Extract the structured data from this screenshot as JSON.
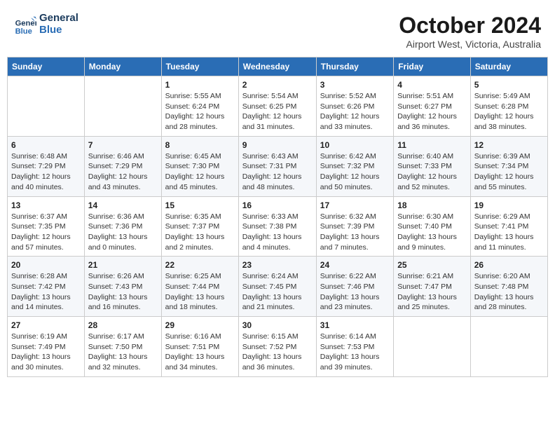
{
  "header": {
    "logo_line1": "General",
    "logo_line2": "Blue",
    "title": "October 2024",
    "subtitle": "Airport West, Victoria, Australia"
  },
  "calendar": {
    "days_of_week": [
      "Sunday",
      "Monday",
      "Tuesday",
      "Wednesday",
      "Thursday",
      "Friday",
      "Saturday"
    ],
    "weeks": [
      [
        {
          "day": "",
          "info": ""
        },
        {
          "day": "",
          "info": ""
        },
        {
          "day": "1",
          "info": "Sunrise: 5:55 AM\nSunset: 6:24 PM\nDaylight: 12 hours and 28 minutes."
        },
        {
          "day": "2",
          "info": "Sunrise: 5:54 AM\nSunset: 6:25 PM\nDaylight: 12 hours and 31 minutes."
        },
        {
          "day": "3",
          "info": "Sunrise: 5:52 AM\nSunset: 6:26 PM\nDaylight: 12 hours and 33 minutes."
        },
        {
          "day": "4",
          "info": "Sunrise: 5:51 AM\nSunset: 6:27 PM\nDaylight: 12 hours and 36 minutes."
        },
        {
          "day": "5",
          "info": "Sunrise: 5:49 AM\nSunset: 6:28 PM\nDaylight: 12 hours and 38 minutes."
        }
      ],
      [
        {
          "day": "6",
          "info": "Sunrise: 6:48 AM\nSunset: 7:29 PM\nDaylight: 12 hours and 40 minutes."
        },
        {
          "day": "7",
          "info": "Sunrise: 6:46 AM\nSunset: 7:29 PM\nDaylight: 12 hours and 43 minutes."
        },
        {
          "day": "8",
          "info": "Sunrise: 6:45 AM\nSunset: 7:30 PM\nDaylight: 12 hours and 45 minutes."
        },
        {
          "day": "9",
          "info": "Sunrise: 6:43 AM\nSunset: 7:31 PM\nDaylight: 12 hours and 48 minutes."
        },
        {
          "day": "10",
          "info": "Sunrise: 6:42 AM\nSunset: 7:32 PM\nDaylight: 12 hours and 50 minutes."
        },
        {
          "day": "11",
          "info": "Sunrise: 6:40 AM\nSunset: 7:33 PM\nDaylight: 12 hours and 52 minutes."
        },
        {
          "day": "12",
          "info": "Sunrise: 6:39 AM\nSunset: 7:34 PM\nDaylight: 12 hours and 55 minutes."
        }
      ],
      [
        {
          "day": "13",
          "info": "Sunrise: 6:37 AM\nSunset: 7:35 PM\nDaylight: 12 hours and 57 minutes."
        },
        {
          "day": "14",
          "info": "Sunrise: 6:36 AM\nSunset: 7:36 PM\nDaylight: 13 hours and 0 minutes."
        },
        {
          "day": "15",
          "info": "Sunrise: 6:35 AM\nSunset: 7:37 PM\nDaylight: 13 hours and 2 minutes."
        },
        {
          "day": "16",
          "info": "Sunrise: 6:33 AM\nSunset: 7:38 PM\nDaylight: 13 hours and 4 minutes."
        },
        {
          "day": "17",
          "info": "Sunrise: 6:32 AM\nSunset: 7:39 PM\nDaylight: 13 hours and 7 minutes."
        },
        {
          "day": "18",
          "info": "Sunrise: 6:30 AM\nSunset: 7:40 PM\nDaylight: 13 hours and 9 minutes."
        },
        {
          "day": "19",
          "info": "Sunrise: 6:29 AM\nSunset: 7:41 PM\nDaylight: 13 hours and 11 minutes."
        }
      ],
      [
        {
          "day": "20",
          "info": "Sunrise: 6:28 AM\nSunset: 7:42 PM\nDaylight: 13 hours and 14 minutes."
        },
        {
          "day": "21",
          "info": "Sunrise: 6:26 AM\nSunset: 7:43 PM\nDaylight: 13 hours and 16 minutes."
        },
        {
          "day": "22",
          "info": "Sunrise: 6:25 AM\nSunset: 7:44 PM\nDaylight: 13 hours and 18 minutes."
        },
        {
          "day": "23",
          "info": "Sunrise: 6:24 AM\nSunset: 7:45 PM\nDaylight: 13 hours and 21 minutes."
        },
        {
          "day": "24",
          "info": "Sunrise: 6:22 AM\nSunset: 7:46 PM\nDaylight: 13 hours and 23 minutes."
        },
        {
          "day": "25",
          "info": "Sunrise: 6:21 AM\nSunset: 7:47 PM\nDaylight: 13 hours and 25 minutes."
        },
        {
          "day": "26",
          "info": "Sunrise: 6:20 AM\nSunset: 7:48 PM\nDaylight: 13 hours and 28 minutes."
        }
      ],
      [
        {
          "day": "27",
          "info": "Sunrise: 6:19 AM\nSunset: 7:49 PM\nDaylight: 13 hours and 30 minutes."
        },
        {
          "day": "28",
          "info": "Sunrise: 6:17 AM\nSunset: 7:50 PM\nDaylight: 13 hours and 32 minutes."
        },
        {
          "day": "29",
          "info": "Sunrise: 6:16 AM\nSunset: 7:51 PM\nDaylight: 13 hours and 34 minutes."
        },
        {
          "day": "30",
          "info": "Sunrise: 6:15 AM\nSunset: 7:52 PM\nDaylight: 13 hours and 36 minutes."
        },
        {
          "day": "31",
          "info": "Sunrise: 6:14 AM\nSunset: 7:53 PM\nDaylight: 13 hours and 39 minutes."
        },
        {
          "day": "",
          "info": ""
        },
        {
          "day": "",
          "info": ""
        }
      ]
    ]
  }
}
